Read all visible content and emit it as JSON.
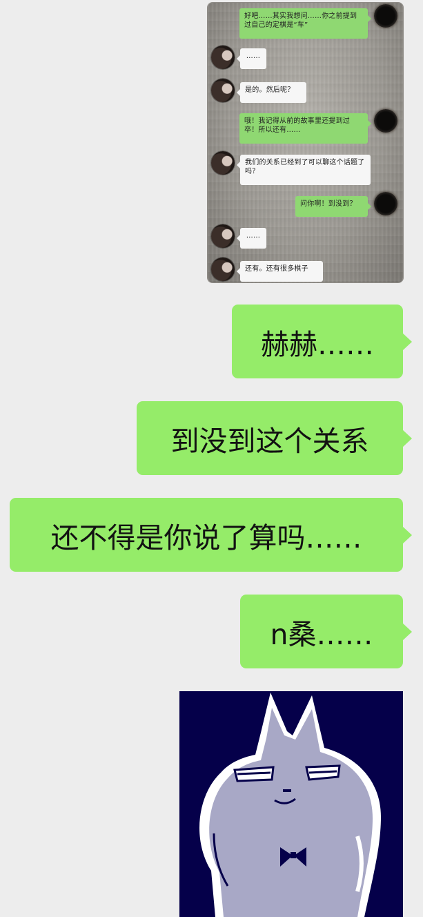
{
  "embedded_screenshot": {
    "messages": [
      {
        "side": "right",
        "text": "好吧……其实我想问……你之前提到过自己的定棋是“车”"
      },
      {
        "side": "left",
        "text": "……"
      },
      {
        "side": "left",
        "text": "是的。然后呢？"
      },
      {
        "side": "right",
        "text": "哦！我记得从前的故事里还提到过卒！所以还有……"
      },
      {
        "side": "left",
        "text": "我们的关系已经到了可以聊这个话题了吗？"
      },
      {
        "side": "right",
        "text": "问你啊！到没到？"
      },
      {
        "side": "left",
        "text": "……"
      },
      {
        "side": "left",
        "text": "还有。还有很多棋子"
      }
    ]
  },
  "chat": {
    "messages": [
      {
        "side": "right",
        "text": "赫赫……"
      },
      {
        "side": "right",
        "text": "到没到这个关系"
      },
      {
        "side": "right",
        "text": "还不得是你说了算吗……"
      },
      {
        "side": "right",
        "text": "n桑……"
      }
    ]
  },
  "sticker": {
    "icon": "smug-cat-sticker",
    "colors": {
      "background": "#05004a",
      "body": "#a8a8c6",
      "outline": "#ffffff"
    }
  },
  "colors": {
    "page_background": "#ededed",
    "sent_bubble": "#95ec69",
    "embedded_sent_bubble": "#8fd872",
    "embedded_received_bubble": "#f6f6f6"
  }
}
